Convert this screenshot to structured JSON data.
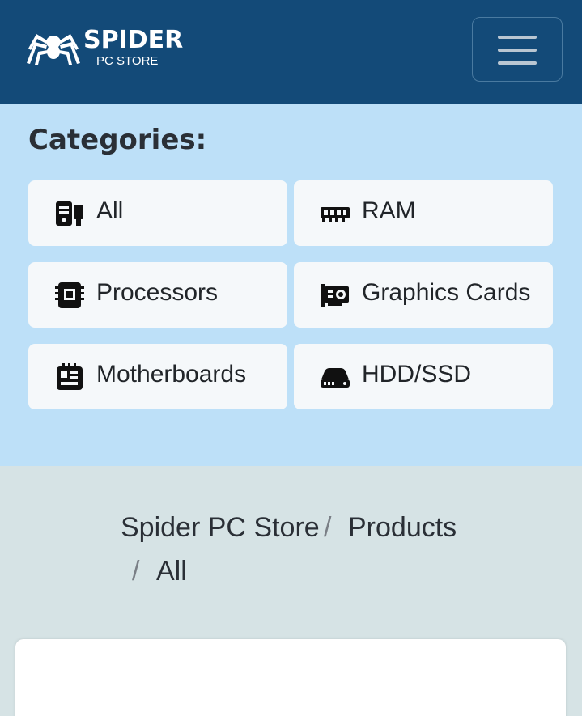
{
  "brand": {
    "name": "SPIDER",
    "subtitle": "PC STORE"
  },
  "categories": {
    "title": "Categories:",
    "items": [
      {
        "label": "All",
        "icon": "pc-tower-icon"
      },
      {
        "label": "RAM",
        "icon": "memory-icon"
      },
      {
        "label": "Processors",
        "icon": "cpu-icon"
      },
      {
        "label": "Graphics Cards",
        "icon": "gpu-icon"
      },
      {
        "label": "Motherboards",
        "icon": "motherboard-icon"
      },
      {
        "label": "HDD/SSD",
        "icon": "hdd-icon"
      }
    ]
  },
  "breadcrumb": {
    "items": [
      "Spider PC Store",
      "Products",
      "All"
    ],
    "separator": "/"
  },
  "colors": {
    "navbar": "#134a78",
    "categories_bg": "#bde0f8",
    "page_bg": "#d6e3e5"
  }
}
